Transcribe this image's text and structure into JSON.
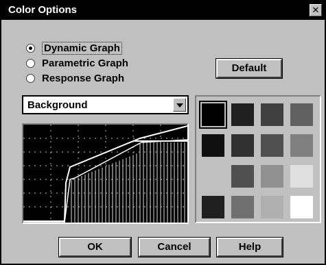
{
  "window": {
    "title": "Color Options"
  },
  "graph_types": [
    {
      "label": "Dynamic Graph",
      "selected": true
    },
    {
      "label": "Parametric Graph",
      "selected": false
    },
    {
      "label": "Response Graph",
      "selected": false
    }
  ],
  "buttons": {
    "default": "Default",
    "ok": "OK",
    "cancel": "Cancel",
    "help": "Help"
  },
  "element_select": {
    "value": "Background"
  },
  "palette": {
    "colors": [
      "#000000",
      "#202020",
      "#404040",
      "#606060",
      "#101010",
      "#303030",
      "#505050",
      "#808080",
      "#c0c0c0",
      "#505050",
      "#909090",
      "#e0e0e0",
      "#202020",
      "#707070",
      "#b0b0b0",
      "#ffffff"
    ],
    "selected_index": 0
  },
  "colors": {
    "face": "#c0c0c0",
    "title_bar": "#000000",
    "graph_background": "#000000"
  }
}
